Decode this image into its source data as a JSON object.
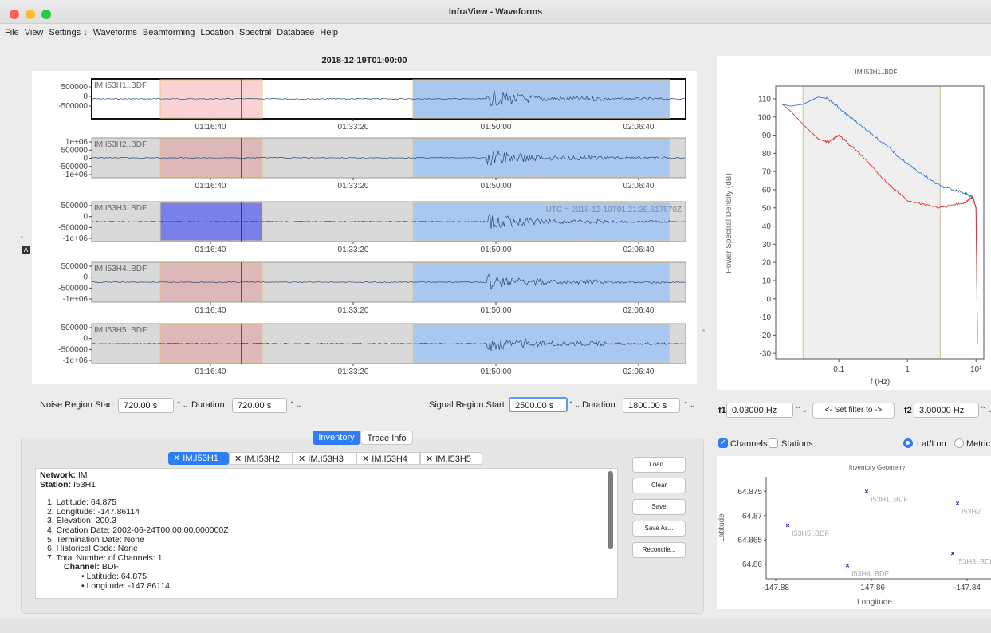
{
  "window": {
    "title": "InfraView - Waveforms"
  },
  "menu": [
    "File",
    "View",
    "Settings ↓",
    "Waveforms",
    "Beamforming",
    "Location",
    "Spectral",
    "Database",
    "Help"
  ],
  "waveforms": {
    "date": "2018-12-19T01:00:00",
    "traces": [
      {
        "label": "IM.I53H1..BDF",
        "yticks": [
          "500000",
          "0",
          "-500000"
        ],
        "noise_color": "#f9d3d3"
      },
      {
        "label": "IM.I53H2..BDF",
        "yticks": [
          "1e+06",
          "500000",
          "0",
          "-500000",
          "-1e+06"
        ],
        "noise_color": "#deb8b8"
      },
      {
        "label": "IM.I53H3..BDF",
        "yticks": [
          "500000",
          "0",
          "-500000",
          "-1e+06"
        ],
        "noise_color": "#7b80e8"
      },
      {
        "label": "IM.I53H4..BDF",
        "yticks": [
          "500000",
          "0",
          "-500000",
          "-1e+06"
        ],
        "noise_color": "#deb8b8"
      },
      {
        "label": "IM.I53H5..BDF",
        "yticks": [
          "500000",
          "0",
          "-500000",
          "-1e+06"
        ],
        "noise_color": "#deb8b8"
      }
    ],
    "xticks": [
      "01:16:40",
      "01:33:20",
      "01:50:00",
      "02:06:40"
    ],
    "utc_readout": "UTC = 2018-12-19T01:21:30.617870Z",
    "a_marker": "A"
  },
  "regions": {
    "noise_start_label": "Noise Region Start:",
    "noise_start_value": "720.00 s",
    "noise_duration_label": "Duration:",
    "noise_duration_value": "720.00 s",
    "signal_start_label": "Signal Region Start:",
    "signal_start_value": "2500.00 s",
    "signal_duration_label": "Duration:",
    "signal_duration_value": "1800.00 s"
  },
  "bottom_tabs": {
    "inventory": "Inventory",
    "trace_info": "Trace Info"
  },
  "channel_tabs": [
    "IM.I53H1",
    "IM.I53H2",
    "IM.I53H3",
    "IM.I53H4",
    "IM.I53H5"
  ],
  "inventory": {
    "network_label": "Network:",
    "network": "IM",
    "station_label": "Station:",
    "station": "I53H1",
    "items": [
      "1. Latitude: 64.875",
      "2. Longitude: -147.86114",
      "3. Elevation: 200.3",
      "4. Creation Date: 2002-06-24T00:00:00.000000Z",
      "5. Termination Date: None",
      "6. Historical Code: None",
      "7. Total Number of Channels: 1"
    ],
    "channel_label": "Channel:",
    "channel": "BDF",
    "channel_items": [
      "Latitude: 64.875",
      "Longitude: -147.86114"
    ]
  },
  "buttons": {
    "load": "Load...",
    "clear": "Clear",
    "save": "Save",
    "save_as": "Save As...",
    "reconcile": "Reconcile..."
  },
  "spectrum": {
    "title": "IM.I53H1..BDF",
    "ylabel": "Power Spectral Density (dB)",
    "xlabel": "f (Hz)",
    "yticks": [
      "110",
      "100",
      "90",
      "80",
      "70",
      "60",
      "50",
      "40",
      "30",
      "20",
      "10",
      "0",
      "-10",
      "-20",
      "-30"
    ],
    "xticks": [
      "0.1",
      "1",
      "10¹"
    ]
  },
  "filter": {
    "f1_label": "f1",
    "f1_value": "0.03000 Hz",
    "set_filter_label": "<- Set filter to ->",
    "f2_label": "f2",
    "f2_value": "3.00000 Hz"
  },
  "geometry": {
    "channels_label": "Channels",
    "stations_label": "Stations",
    "latlon_label": "Lat/Lon",
    "metric_label": "Metric",
    "title": "Inventory Geometry",
    "ylabel": "Latitude",
    "xlabel": "Longitude",
    "yticks": [
      "64.875",
      "64.87",
      "64.865",
      "64.86"
    ],
    "xticks": [
      "-147.88",
      "-147.86",
      "-147.84"
    ],
    "points": [
      "I53H1..BDF",
      "I53H2",
      "I53H5..BDF",
      "I53H4..BDF",
      "I53H3..BDF"
    ]
  },
  "chart_data": [
    {
      "type": "line",
      "title": "IM.I53H1..BDF",
      "xlabel": "f (Hz)",
      "ylabel": "Power Spectral Density (dB)",
      "xscale": "log",
      "ylim": [
        -30,
        115
      ],
      "series": [
        {
          "color": "#2f7bd0",
          "x": [
            0.015,
            0.02,
            0.03,
            0.05,
            0.07,
            0.1,
            0.2,
            0.5,
            1,
            3,
            7,
            9,
            10,
            10.5
          ],
          "y": [
            107,
            106,
            107,
            111,
            110,
            105,
            96,
            84,
            74,
            62,
            58,
            56,
            50,
            -25
          ]
        },
        {
          "color": "#e03030",
          "x": [
            0.015,
            0.02,
            0.03,
            0.05,
            0.07,
            0.1,
            0.2,
            0.5,
            1,
            3,
            7,
            9,
            10,
            10.5
          ],
          "y": [
            107,
            103,
            96,
            88,
            86,
            90,
            80,
            64,
            54,
            50,
            53,
            56,
            50,
            -23
          ]
        }
      ]
    },
    {
      "type": "scatter",
      "title": "Inventory Geometry",
      "xlabel": "Longitude",
      "ylabel": "Latitude",
      "xlim": [
        -147.882,
        -147.835
      ],
      "ylim": [
        64.857,
        64.878
      ],
      "points": [
        {
          "label": "I53H1..BDF",
          "x": -147.861,
          "y": 64.875
        },
        {
          "label": "I53H2",
          "x": -147.842,
          "y": 64.8725
        },
        {
          "label": "I53H5..BDF",
          "x": -147.8775,
          "y": 64.868
        },
        {
          "label": "I53H4..BDF",
          "x": -147.865,
          "y": 64.8597
        },
        {
          "label": "I53H3..BDF",
          "x": -147.843,
          "y": 64.8622
        }
      ]
    }
  ]
}
